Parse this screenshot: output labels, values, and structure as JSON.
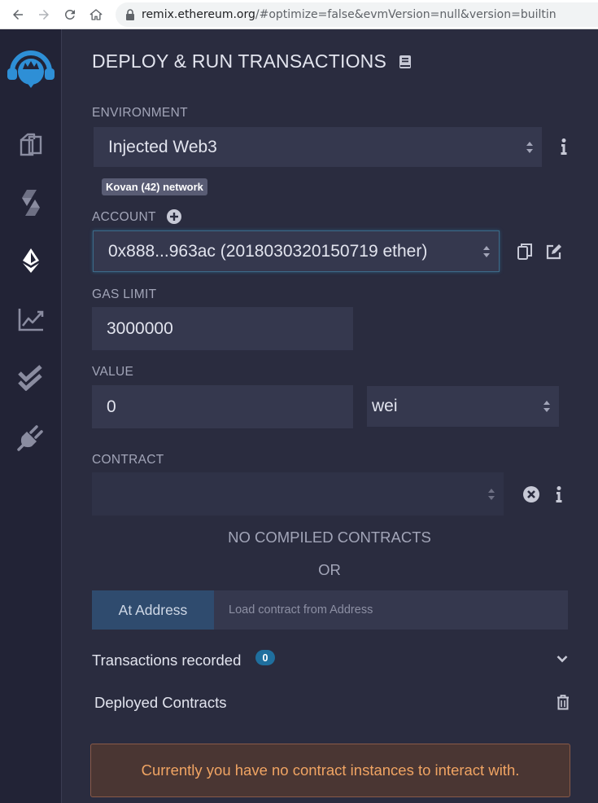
{
  "browser": {
    "url_host": "remix.ethereum.org",
    "url_rest": "/#optimize=false&evmVersion=null&version=builtin"
  },
  "icon_panel": {
    "items": [
      {
        "icon": "remix-logo-icon"
      },
      {
        "icon": "file-explorer-icon"
      },
      {
        "icon": "solidity-compiler-icon"
      },
      {
        "icon": "deploy-run-icon",
        "active": true
      },
      {
        "icon": "analysis-chart-icon"
      },
      {
        "icon": "testing-check-icon"
      },
      {
        "icon": "plugin-manager-icon"
      }
    ]
  },
  "panel": {
    "title": "DEPLOY & RUN TRANSACTIONS",
    "environment": {
      "label": "ENVIRONMENT",
      "value": "Injected Web3",
      "network_badge": "Kovan (42) network"
    },
    "account": {
      "label": "ACCOUNT",
      "value": "0x888...963ac (2018030320150719 ether)"
    },
    "gas_limit": {
      "label": "GAS LIMIT",
      "value": "3000000"
    },
    "value": {
      "label": "VALUE",
      "amount": "0",
      "unit": "wei"
    },
    "contract": {
      "label": "CONTRACT",
      "value": "",
      "no_compiled": "NO COMPILED CONTRACTS",
      "or": "OR"
    },
    "at_address": {
      "button_label": "At Address",
      "placeholder": "Load contract from Address"
    },
    "transactions": {
      "label": "Transactions recorded",
      "count": "0"
    },
    "deployed": {
      "label": "Deployed Contracts",
      "empty_message": "Currently you have no contract instances to interact with."
    }
  },
  "colors": {
    "panel_bg": "#2a2c3f",
    "icon_panel_bg": "#222336",
    "input_bg": "#35384e",
    "accent_blue": "#1f6f9e",
    "warning_text": "#f0a463"
  }
}
